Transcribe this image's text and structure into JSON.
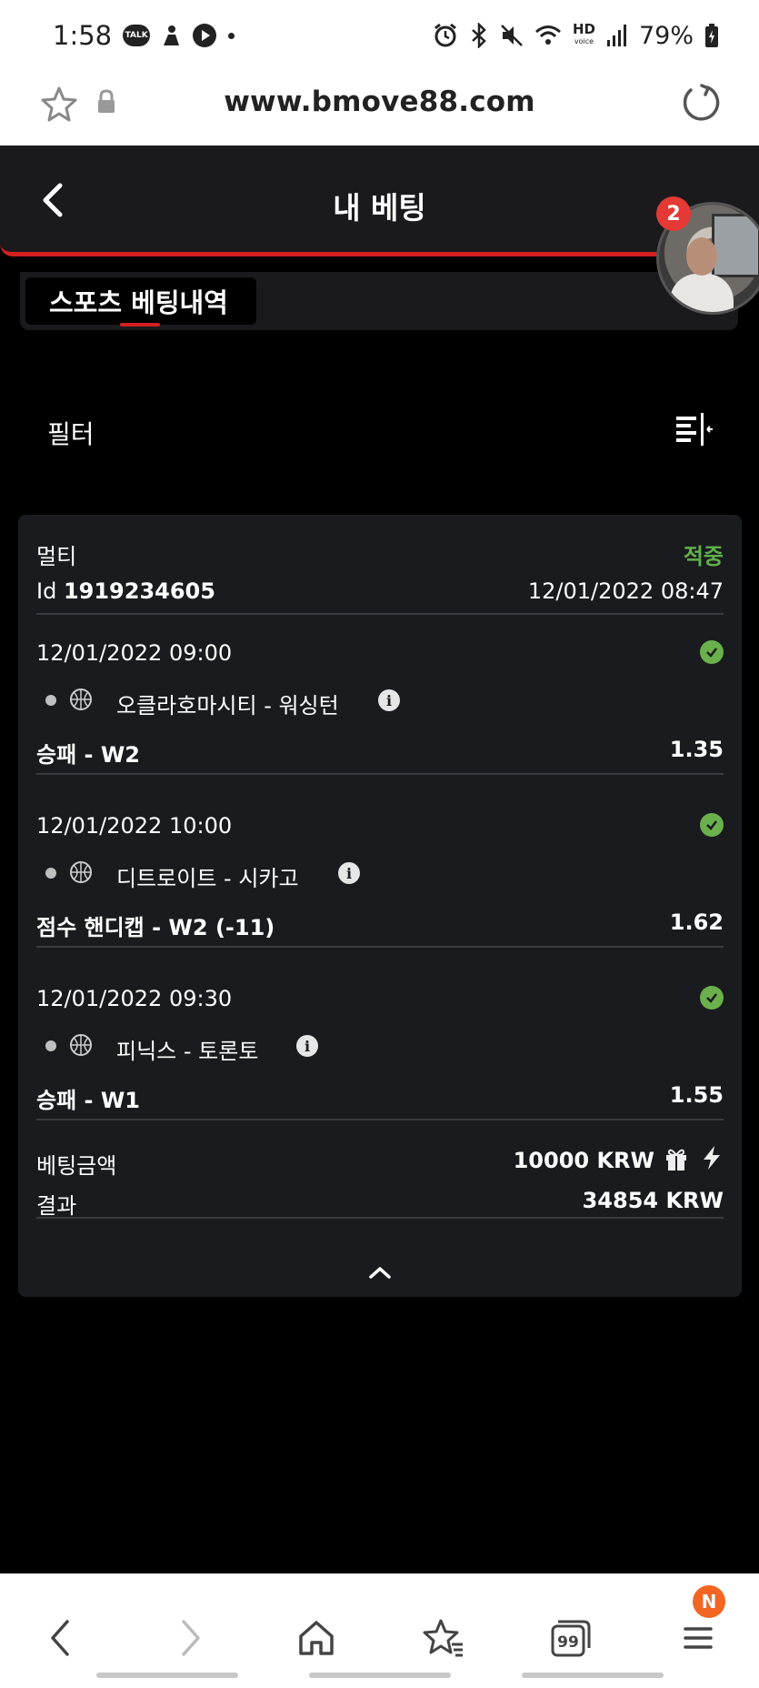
{
  "status_bar": {
    "time": "1:58",
    "talk_badge": "TALK",
    "battery": "79%",
    "hd_label": "HD",
    "voice_label": "voice"
  },
  "browser": {
    "url": "www.bmove88.com"
  },
  "header": {
    "title": "내 베팅",
    "avatar_badge_count": "2"
  },
  "tabs": {
    "active_label": "스포츠 베팅내역"
  },
  "filter": {
    "label": "필터"
  },
  "bet": {
    "type": "멀티",
    "status": "적중",
    "id_label": "Id",
    "id_value": "1919234605",
    "placed_at": "12/01/2022 08:47",
    "selections": [
      {
        "datetime": "12/01/2022 09:00",
        "match": "오클라호마시티 - 워싱턴",
        "market": "승패 - W2",
        "odds": "1.35"
      },
      {
        "datetime": "12/01/2022 10:00",
        "match": "디트로이트 - 시카고",
        "market": "점수 핸디캡 - W2 (-11)",
        "odds": "1.62"
      },
      {
        "datetime": "12/01/2022 09:30",
        "match": "피닉스 - 토론토",
        "market": "승패 - W1",
        "odds": "1.55"
      }
    ],
    "stake_label": "베팅금액",
    "stake_value": "10000 KRW",
    "result_label": "결과",
    "result_value": "34854 KRW"
  },
  "bottom_nav": {
    "tabs_count": "99",
    "menu_badge": "N"
  },
  "colors": {
    "accent_red": "#d32020",
    "win_green": "#5fb24a",
    "card_bg": "#1a1b1f"
  }
}
